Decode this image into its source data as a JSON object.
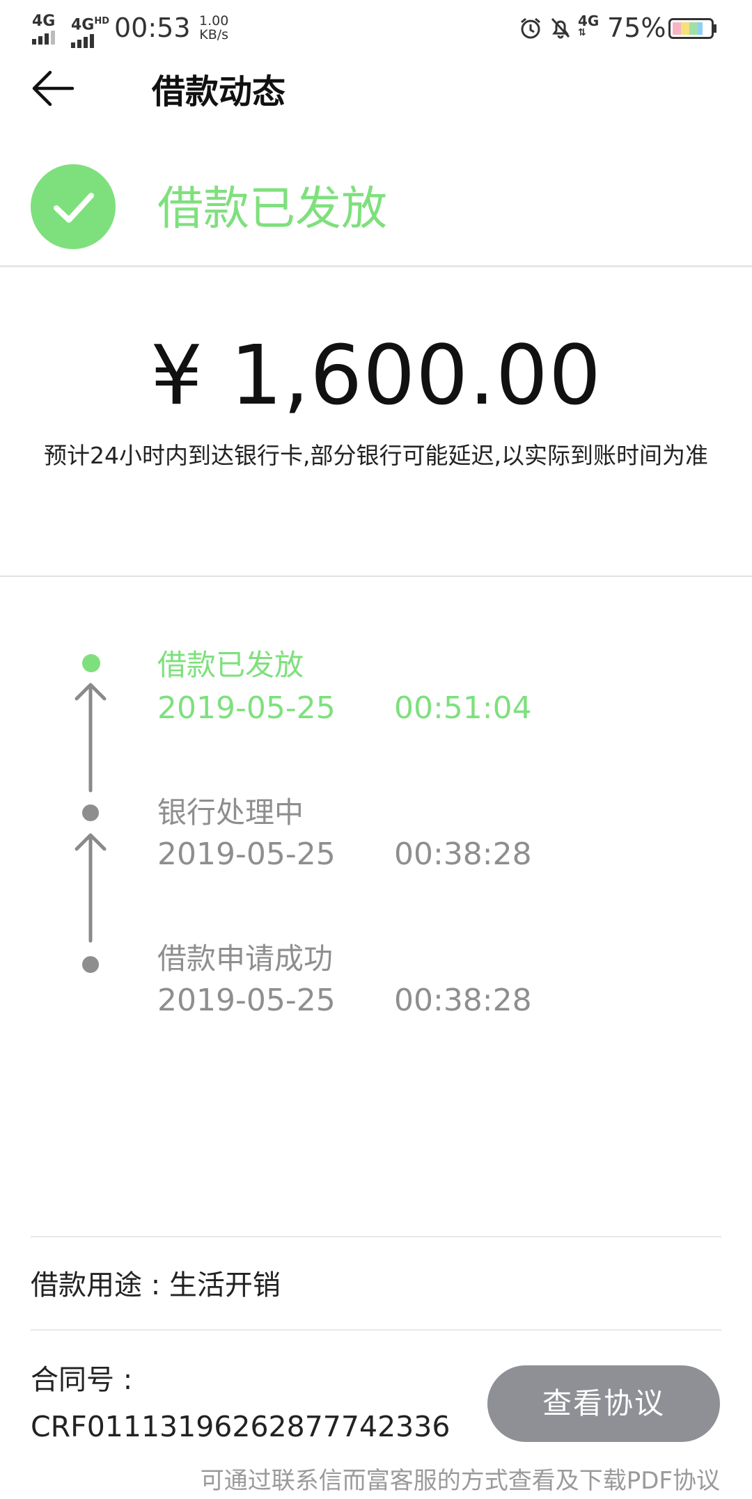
{
  "status_bar": {
    "network1": "4G",
    "network2": "4G",
    "network2_sup": "HD",
    "time": "00:53",
    "speed_value": "1.00",
    "speed_unit": "KB/s",
    "mobile_data": "4G",
    "battery": "75%"
  },
  "header": {
    "title": "借款动态"
  },
  "status": {
    "text": "借款已发放",
    "color": "#7ee07d"
  },
  "amount": "¥ 1,600.00",
  "arrival_note": "预计24小时内到达银行卡,部分银行可能延迟,以实际到账时间为准",
  "timeline": [
    {
      "label": "借款已发放",
      "date": "2019-05-25",
      "time": "00:51:04",
      "active": true
    },
    {
      "label": "银行处理中",
      "date": "2019-05-25",
      "time": "00:38:28",
      "active": false
    },
    {
      "label": "借款申请成功",
      "date": "2019-05-25",
      "time": "00:38:28",
      "active": false
    }
  ],
  "purpose": "借款用途 : 生活开销",
  "contract": {
    "label": "合同号 :",
    "number": "CRF01113196262877742336"
  },
  "view_agreement_button": "查看协议",
  "footer_note": "可通过联系信而富客服的方式查看及下载PDF协议",
  "colors": {
    "accent_green": "#7ee07d",
    "button_grey": "#8e9095",
    "text_grey": "#8e8e8e"
  }
}
